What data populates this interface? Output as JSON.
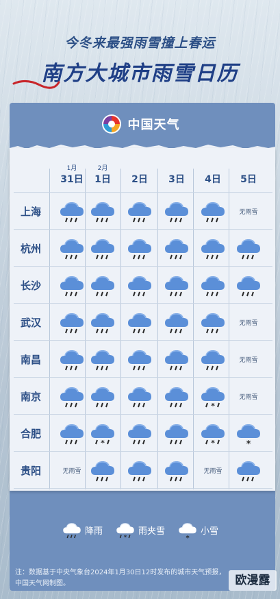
{
  "header": {
    "subtitle": "今冬来最强雨雪撞上春运",
    "title": "南方大城市雨雪日历"
  },
  "brand": {
    "name": "中国天气",
    "logo_icon": "china-weather-logo-icon"
  },
  "table": {
    "dates": [
      {
        "month": "1月",
        "day": "31日"
      },
      {
        "month": "2月",
        "day": "1日"
      },
      {
        "month": "",
        "day": "2日"
      },
      {
        "month": "",
        "day": "3日"
      },
      {
        "month": "",
        "day": "4日"
      },
      {
        "month": "",
        "day": "5日"
      }
    ],
    "none_label": "无雨雪",
    "rows": [
      {
        "city": "上海",
        "cells": [
          "rain",
          "rain",
          "rain",
          "rain",
          "rain",
          "none"
        ]
      },
      {
        "city": "杭州",
        "cells": [
          "rain",
          "rain",
          "rain",
          "rain",
          "rain",
          "rain"
        ]
      },
      {
        "city": "长沙",
        "cells": [
          "rain",
          "rain",
          "rain",
          "rain",
          "rain",
          "rain"
        ]
      },
      {
        "city": "武汉",
        "cells": [
          "rain",
          "rain",
          "rain",
          "rain",
          "rain",
          "none"
        ]
      },
      {
        "city": "南昌",
        "cells": [
          "rain",
          "rain",
          "rain",
          "rain",
          "rain",
          "none"
        ]
      },
      {
        "city": "南京",
        "cells": [
          "rain",
          "rain",
          "rain",
          "rain",
          "sleet",
          "none"
        ]
      },
      {
        "city": "合肥",
        "cells": [
          "rain",
          "sleet",
          "rain",
          "rain",
          "sleet",
          "snow"
        ]
      },
      {
        "city": "贵阳",
        "cells": [
          "none",
          "rain",
          "rain",
          "rain",
          "none",
          "rain"
        ]
      }
    ]
  },
  "legend": [
    {
      "type": "rain",
      "label": "降雨"
    },
    {
      "type": "sleet",
      "label": "雨夹雪"
    },
    {
      "type": "snow",
      "label": "小雪"
    }
  ],
  "note": {
    "line1": "注：数据基于中央气象台2024年1月30日12时发布的城市天气预报，",
    "line2": "中国天气网制图。"
  },
  "watermark": "欧漫露",
  "colors": {
    "title": "#1f3f86",
    "card": "#6f8fbd",
    "cloud": "#5b8fd8",
    "sheet": "#eef2f8"
  }
}
